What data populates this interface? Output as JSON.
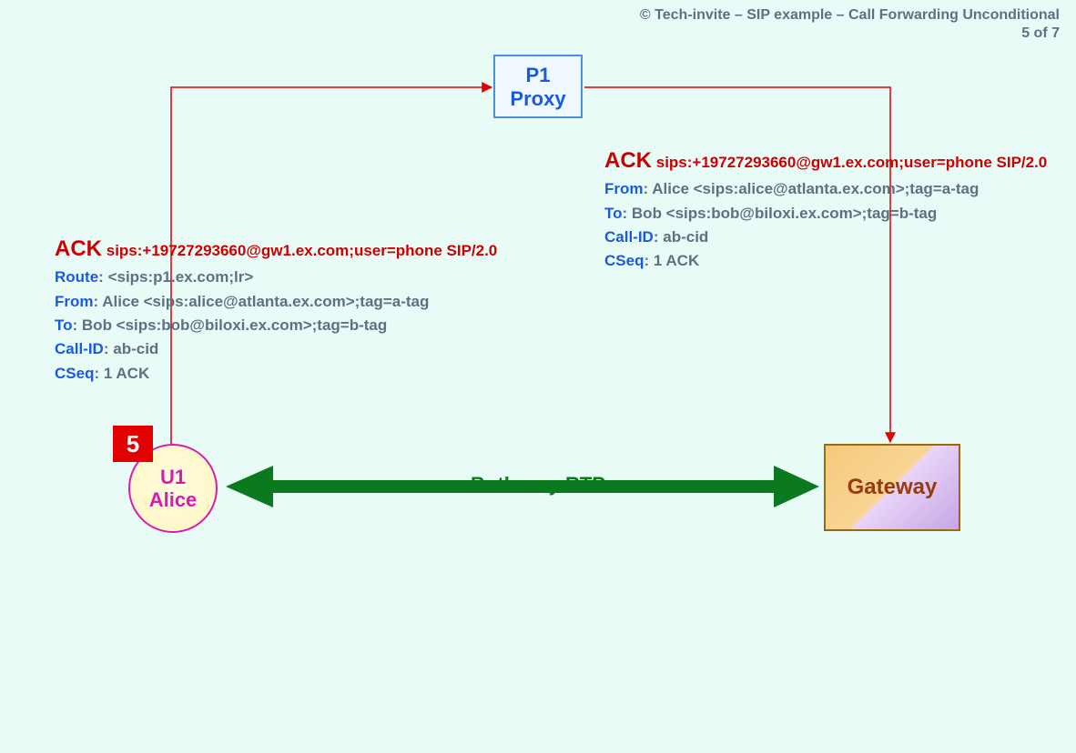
{
  "header": {
    "copyright_line": "© Tech-invite – SIP example – Call Forwarding Unconditional",
    "page_of": "5 of 7"
  },
  "nodes": {
    "proxy": {
      "line1": "P1",
      "line2": "Proxy"
    },
    "alice": {
      "line1": "U1",
      "line2": "Alice"
    },
    "gateway": {
      "label": "Gateway"
    },
    "step_number": "5"
  },
  "rtp_label": "Both way RTP",
  "msg_left": {
    "method": "ACK",
    "request_uri": "sips:+19727293660@gw1.ex.com;user=phone SIP/2.0",
    "headers": [
      {
        "name": "Route",
        "value": "<sips:p1.ex.com;lr>"
      },
      {
        "name": "From",
        "value": "Alice <sips:alice@atlanta.ex.com>;tag=a-tag"
      },
      {
        "name": "To",
        "value": "Bob <sips:bob@biloxi.ex.com>;tag=b-tag"
      },
      {
        "name": "Call-ID",
        "value": "ab-cid"
      },
      {
        "name": "CSeq",
        "value": "1 ACK"
      }
    ]
  },
  "msg_right": {
    "method": "ACK",
    "request_uri": "sips:+19727293660@gw1.ex.com;user=phone SIP/2.0",
    "headers": [
      {
        "name": "From",
        "value": "Alice <sips:alice@atlanta.ex.com>;tag=a-tag"
      },
      {
        "name": "To",
        "value": "Bob <sips:bob@biloxi.ex.com>;tag=b-tag"
      },
      {
        "name": "Call-ID",
        "value": "ab-cid"
      },
      {
        "name": "CSeq",
        "value": "1 ACK"
      }
    ]
  }
}
